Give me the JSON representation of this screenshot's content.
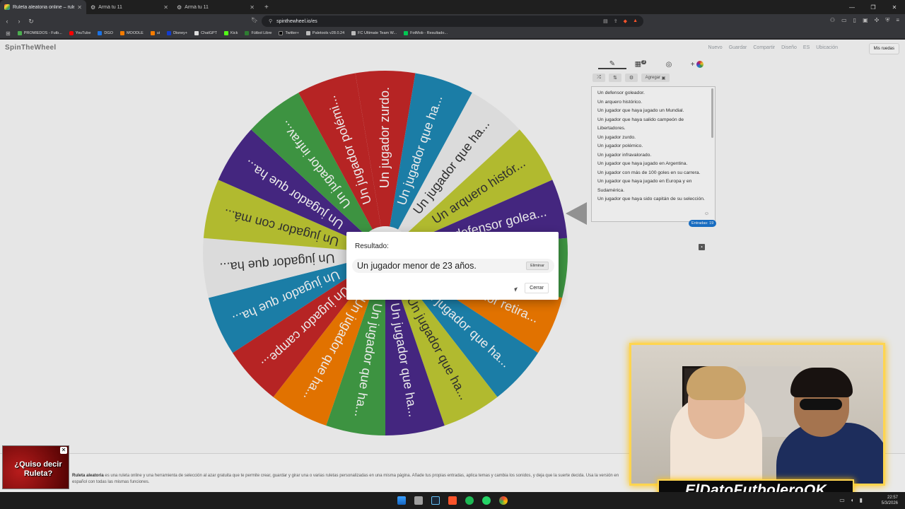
{
  "browser": {
    "tabs": [
      {
        "title": "Ruleta aleatoria online – ruleta o",
        "active": true
      },
      {
        "title": "Armá tu 11",
        "active": false
      },
      {
        "title": "Armá tu 11",
        "active": false
      }
    ],
    "url": "spinthewheel.io/es",
    "bookmarks": [
      "PROMIEDOS - Futb...",
      "YouTube",
      "DGO",
      "MOODLE",
      "ui",
      "Disney+",
      "ChatGPT",
      "Kick",
      "Fútbol Libre",
      "Twitter+",
      "Paletools v28.0.24",
      "FC Ultimate Team W...",
      "FotMob - Resultado..."
    ]
  },
  "site": {
    "logo": "SpinTheWheel",
    "nav": [
      "Nuevo",
      "Guardar",
      "Compartir",
      "Diseño",
      "ES",
      "Ubicación"
    ],
    "my_wheels": "Mis ruedas"
  },
  "wheel": {
    "colors": [
      "#c62828",
      "#1e88b5",
      "#eeeeee",
      "#c0ca33",
      "#4a2a8a",
      "#43a047",
      "#f57c00",
      "#1e88b5",
      "#c0ca33",
      "#4a2a8a",
      "#43a047",
      "#f57c00",
      "#c62828",
      "#1e88b5",
      "#eeeeee",
      "#c0ca33",
      "#4a2a8a",
      "#43a047",
      "#c62828"
    ],
    "labels": [
      "Un jugador zurdo.",
      "Un jugador que ha...",
      "Un jugador que ha...",
      "Un arquero histór...",
      "Un defensor golea...",
      "Un jugador menor...",
      "Un jugador retira...",
      "Un jugador que ha...",
      "Un jugador que ha...",
      "Un jugador que ha...",
      "Un jugador que ha...",
      "Un jugador que ha...",
      "Un jugador campe...",
      "Un jugador que ha...",
      "Un jugador que ha...",
      "Un jugador con má...",
      "Un jugador que ha...",
      "Un jugador infrav...",
      "Un jugador polémi..."
    ]
  },
  "panel": {
    "tab_badge": "3",
    "add_label": "Agregar",
    "entries": [
      "Un defensor goleador.",
      "Un arquero histórico.",
      "Un jugador que haya jugado un Mundial.",
      "Un jugador que haya salido campeón de Libertadores.",
      "Un jugador zurdo.",
      "Un jugador polémico.",
      "Un jugador infravalorado.",
      "Un jugador que haya jugado en Argentina.",
      "Un jugador con más de 100 goles en su carrera.",
      "Un jugador que haya jugado en Europa y en Sudamérica.",
      "Un jugador que haya sido capitán de su selección."
    ],
    "count_label": "Entradas: 19"
  },
  "dialog": {
    "label": "Resultado:",
    "result": "Un jugador menor de 23 años.",
    "delete_label": "Eliminar",
    "close_label": "Cerrar"
  },
  "footer": {
    "bold": "Ruleta aleatoria",
    "text": " es una ruleta online y una herramienta de selección al azar gratuita que te permite crear, guardar y girar una o varias ruletas personalizadas en una misma página. Añade tus propias entradas, aplica temas y cambia los sonidos, y deja que la suerte decida. Usa la versión en español con todas las mismas funciones."
  },
  "ad": {
    "text": "¿Quiso decir Ruleta?"
  },
  "stream": {
    "banner": "ElDatoFutboleroOK"
  },
  "system": {
    "time": "22:57",
    "date": "5/3/2026"
  }
}
